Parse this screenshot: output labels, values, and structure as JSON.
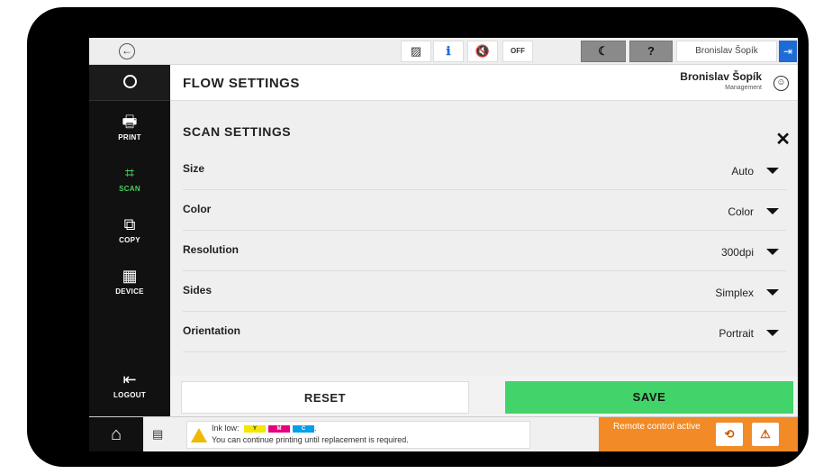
{
  "topbar": {
    "back_icon": "←",
    "status_icons": [
      {
        "name": "toner-warning-icon",
        "glyph": "▨"
      },
      {
        "name": "info-status-icon",
        "glyph": "ℹ"
      },
      {
        "name": "mute-sound-icon",
        "glyph": "🔇"
      },
      {
        "name": "quiet-mode-off-icon",
        "glyph": "OFF"
      },
      {
        "name": "sleep-mode-icon",
        "glyph": "☾"
      },
      {
        "name": "help-icon",
        "glyph": "?"
      }
    ],
    "user_name": "Bronislav Šopík",
    "logout_icon": "⇥"
  },
  "sidebar": {
    "items": [
      {
        "label": "PRINT",
        "icon": "🖶",
        "active": false
      },
      {
        "label": "SCAN",
        "icon": "⌗",
        "active": true
      },
      {
        "label": "COPY",
        "icon": "⧉",
        "active": false
      },
      {
        "label": "DEVICE",
        "icon": "▦",
        "active": false
      },
      {
        "label": "LOGOUT",
        "icon": "⇤",
        "active": false
      }
    ]
  },
  "header": {
    "title": "FLOW SETTINGS",
    "user_name": "Bronislav Šopík",
    "user_role": "Management",
    "avatar_icon": "☺"
  },
  "panel": {
    "title": "SCAN SETTINGS",
    "close_icon": "✕",
    "rows": [
      {
        "label": "Size",
        "value": "Auto"
      },
      {
        "label": "Color",
        "value": "Color"
      },
      {
        "label": "Resolution",
        "value": "300dpi"
      },
      {
        "label": "Sides",
        "value": "Simplex"
      },
      {
        "label": "Orientation",
        "value": "Portrait"
      }
    ]
  },
  "buttons": {
    "reset": "RESET",
    "save": "SAVE"
  },
  "bottom": {
    "home_icon": "⌂",
    "jobs_icon": "▤",
    "warning_line1": "Ink low:",
    "ink_labels": [
      "Y",
      "M",
      "C"
    ],
    "ink_colors": [
      "#f3e600",
      "#e5007e",
      "#00a0e9"
    ],
    "warning_suffix": ".",
    "warning_line2": "You can continue printing until replacement is required.",
    "remote_text": "Remote control active",
    "remote_btn1": "⟲",
    "remote_btn2": "⚠"
  }
}
